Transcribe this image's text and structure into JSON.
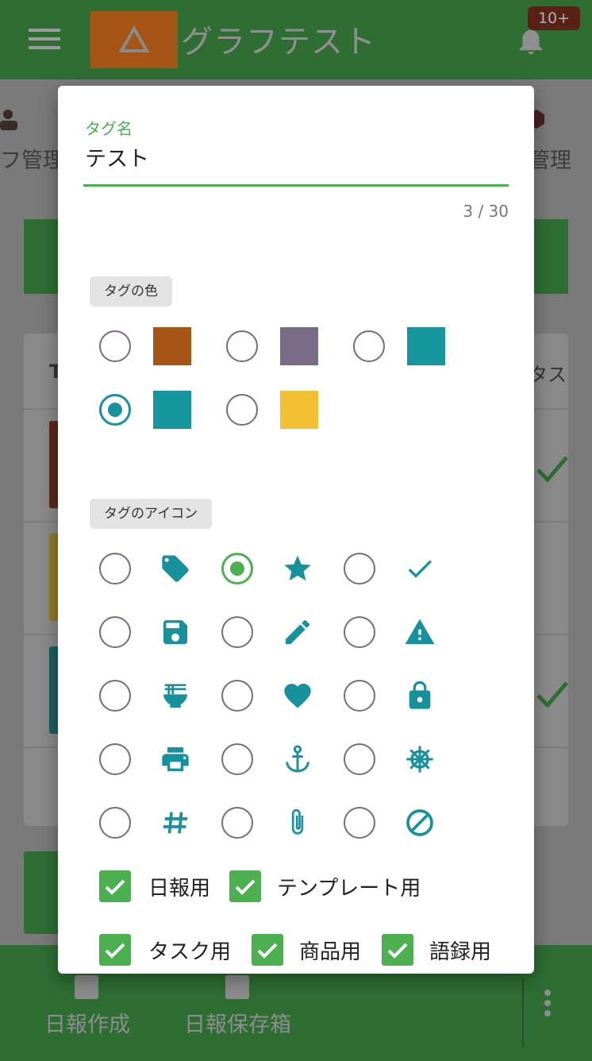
{
  "app": {
    "title": "グラフテスト",
    "notification_badge": "10+",
    "left_label": "フ管理",
    "right_label": "管理",
    "table_header_first": "T",
    "table_header_last": "タス"
  },
  "bottom_nav": {
    "create_label": "日報作成",
    "saved_label": "日報保存箱"
  },
  "dialog": {
    "name_field": {
      "label": "タグ名",
      "value": "テスト",
      "counter": "3 / 30"
    },
    "color_section": {
      "title": "タグの色",
      "options": [
        {
          "color": "#a55516",
          "selected": false
        },
        {
          "color": "#7b6b85",
          "selected": false
        },
        {
          "color": "#17969e",
          "selected": false
        },
        {
          "color": "#17969e",
          "selected": true
        },
        {
          "color": "#f3c136",
          "selected": false
        }
      ]
    },
    "icon_section": {
      "title": "タグのアイコン",
      "icon_color": "#17919c",
      "options": [
        {
          "icon": "tag-icon",
          "selected": false
        },
        {
          "icon": "star-icon",
          "selected": true
        },
        {
          "icon": "check-icon",
          "selected": false
        },
        {
          "icon": "save-icon",
          "selected": false
        },
        {
          "icon": "pencil-icon",
          "selected": false
        },
        {
          "icon": "warning-icon",
          "selected": false
        },
        {
          "icon": "ramen-bowl-icon",
          "selected": false
        },
        {
          "icon": "heart-icon",
          "selected": false
        },
        {
          "icon": "lock-icon",
          "selected": false
        },
        {
          "icon": "printer-icon",
          "selected": false
        },
        {
          "icon": "anchor-icon",
          "selected": false
        },
        {
          "icon": "ship-wheel-icon",
          "selected": false
        },
        {
          "icon": "hashtag-icon",
          "selected": false
        },
        {
          "icon": "paperclip-icon",
          "selected": false
        },
        {
          "icon": "block-icon",
          "selected": false
        }
      ]
    },
    "usage": [
      {
        "label": "日報用",
        "checked": true
      },
      {
        "label": "テンプレート用",
        "checked": true
      },
      {
        "label": "タスク用",
        "checked": true
      },
      {
        "label": "商品用",
        "checked": true
      },
      {
        "label": "語録用",
        "checked": true
      }
    ]
  }
}
